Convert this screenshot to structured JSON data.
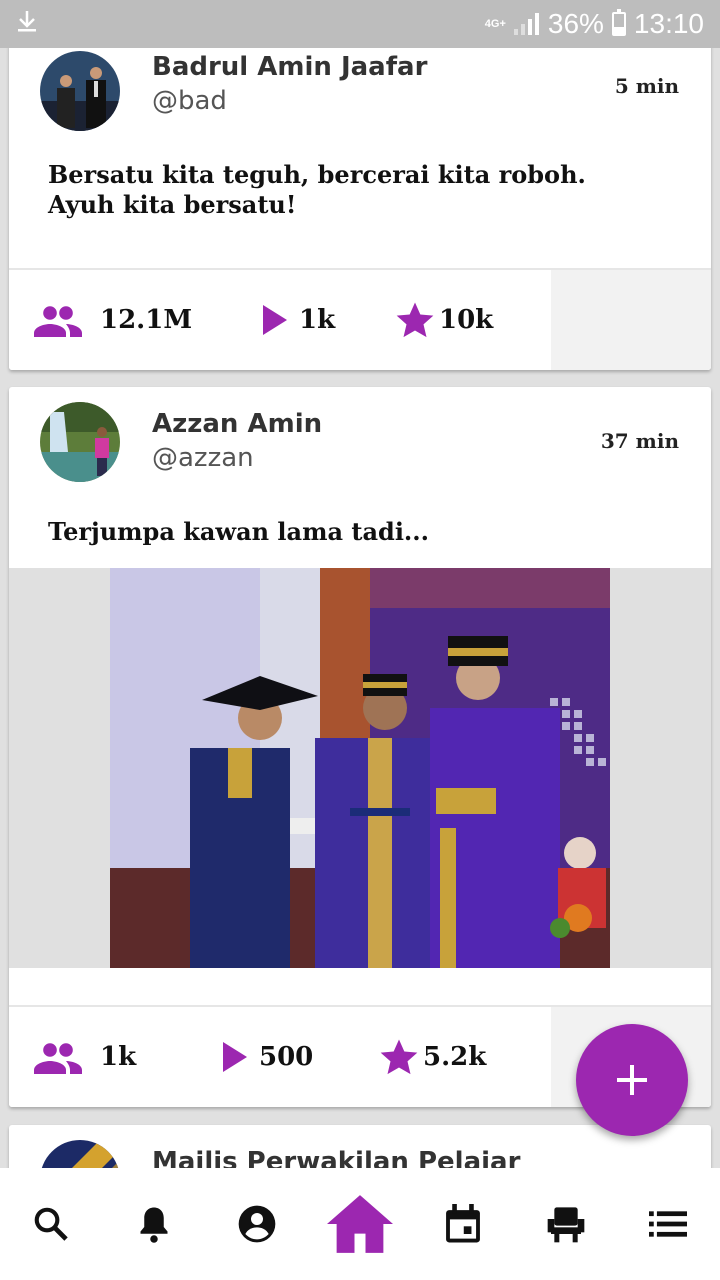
{
  "status_bar": {
    "network": "4G+",
    "battery": "36%",
    "time": "13:10"
  },
  "posts": [
    {
      "name": "Badrul Amin Jaafar",
      "handle": "@bad",
      "time": "5 min",
      "text": "Bersatu kita teguh, bercerai kita roboh. Ayuh kita bersatu!",
      "stats": {
        "followers": "12.1M",
        "plays": "1k",
        "stars": "10k"
      }
    },
    {
      "name": "Azzan Amin",
      "handle": "@azzan",
      "time": "37 min",
      "text": "Terjumpa kawan lama tadi...",
      "stats": {
        "followers": "1k",
        "plays": "500",
        "stars": "5.2k"
      }
    },
    {
      "name": "Majlis Perwakilan Pelajar"
    }
  ],
  "colors": {
    "accent": "#9c27b0",
    "status_bar": "#bdbdbd",
    "background": "#e0e0e0"
  },
  "icons": {
    "fab": "plus-icon",
    "stats": [
      "group-icon",
      "play-icon",
      "star-icon"
    ],
    "nav": [
      "search-icon",
      "bell-icon",
      "account-icon",
      "home-icon",
      "calendar-icon",
      "seat-icon",
      "list-icon"
    ]
  }
}
